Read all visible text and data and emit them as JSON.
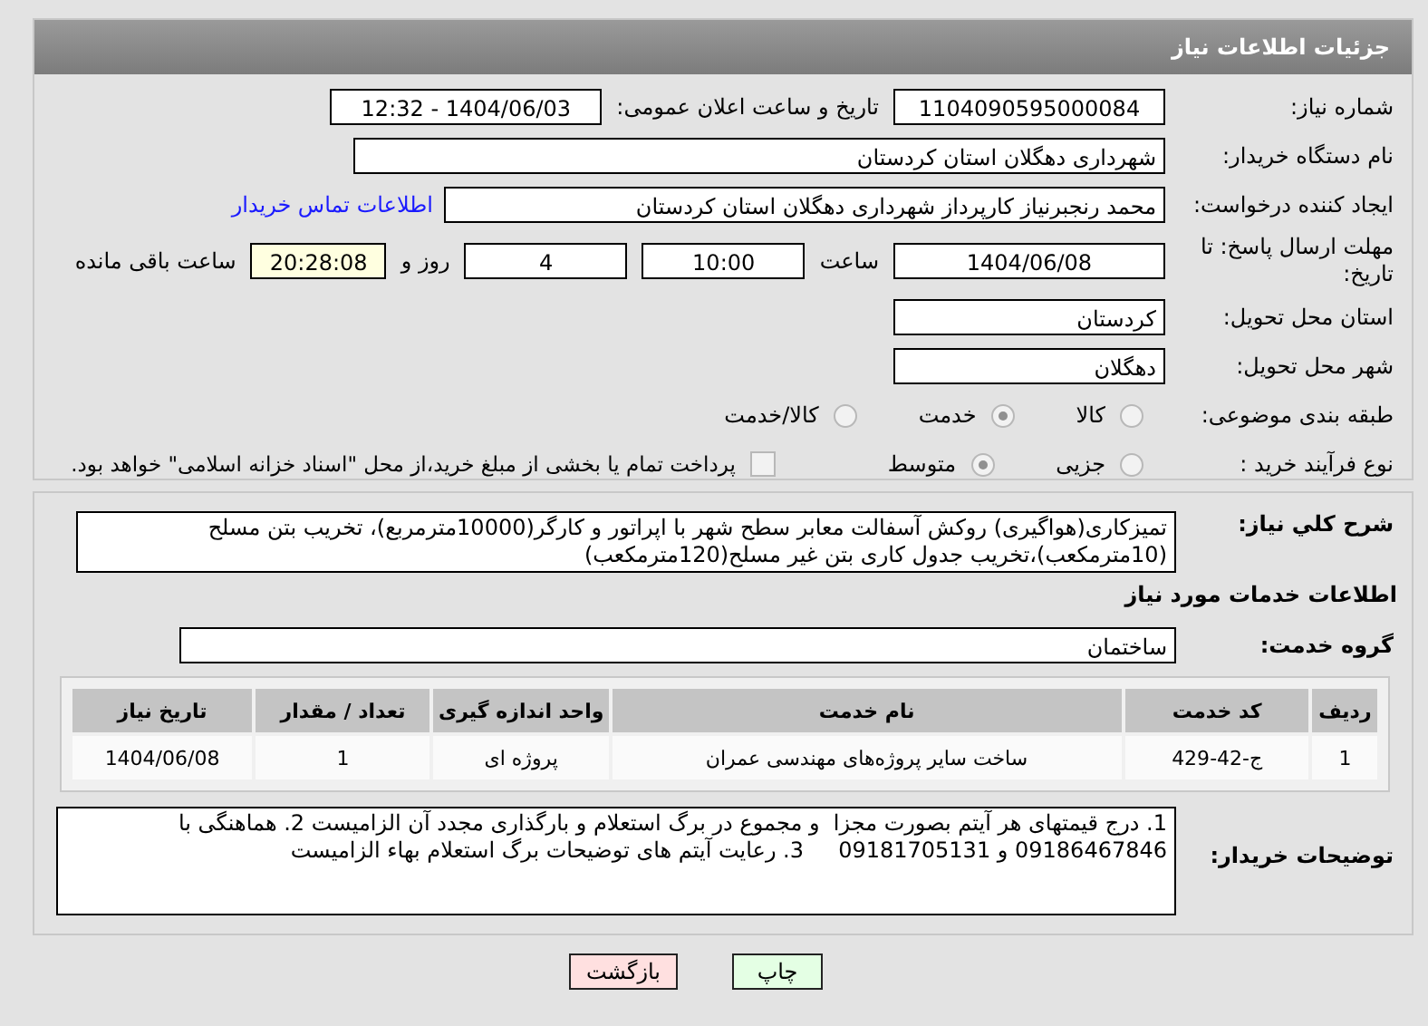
{
  "page_title": "جزئیات اطلاعات نیاز",
  "need_number": {
    "label": "شماره نیاز:",
    "value": "1104090595000084"
  },
  "announce": {
    "label": "تاریخ و ساعت اعلان عمومی:",
    "value": "1404/06/03 - 12:32"
  },
  "buyer": {
    "label": "نام دستگاه خریدار:",
    "value": "شهرداری دهگلان استان کردستان"
  },
  "requester": {
    "label": "ایجاد کننده درخواست:",
    "value": "محمد رنجبرنیاز کارپرداز شهرداری دهگلان استان کردستان",
    "link": "اطلاعات تماس خریدار"
  },
  "deadline": {
    "label": "مهلت ارسال پاسخ: تا تاریخ:",
    "date": "1404/06/08",
    "time_label": "ساعت",
    "time": "10:00",
    "days": "4",
    "days_label": "روز و",
    "remaining": "20:28:08",
    "remaining_label": "ساعت باقی مانده"
  },
  "province": {
    "label": "استان محل تحویل:",
    "value": "کردستان"
  },
  "city": {
    "label": "شهر محل تحویل:",
    "value": "دهگلان"
  },
  "category": {
    "label": "طبقه بندی موضوعی:",
    "options": [
      {
        "label": "کالا",
        "selected": false
      },
      {
        "label": "خدمت",
        "selected": true
      },
      {
        "label": "کالا/خدمت",
        "selected": false
      }
    ]
  },
  "process": {
    "label": "نوع فرآیند خرید :",
    "options": [
      {
        "label": "جزیی",
        "selected": false
      },
      {
        "label": "متوسط",
        "selected": true
      }
    ],
    "payment": {
      "checked": false,
      "text": "پرداخت تمام یا بخشی از مبلغ خرید،از محل \"اسناد خزانه اسلامی\" خواهد بود."
    }
  },
  "description": {
    "label": "شرح کلي نياز:",
    "text": "تمیزکاری(هواگیری) روکش آسفالت معابر سطح شهر با اپراتور و کارگر(10000مترمربع)، تخریب بتن مسلح (10مترمکعب)،تخریب جدول کاری بتن غیر مسلح(120مترمکعب)"
  },
  "services_heading": "اطلاعات خدمات مورد نیاز",
  "service_group": {
    "label": "گروه خدمت:",
    "value": "ساختمان"
  },
  "table": {
    "columns": [
      "ردیف",
      "کد خدمت",
      "نام خدمت",
      "واحد اندازه گیری",
      "تعداد / مقدار",
      "تاریخ نیاز"
    ],
    "rows": [
      [
        "1",
        "ج-42-429",
        "ساخت سایر پروژه‌های مهندسی عمران",
        "پروژه ای",
        "1",
        "1404/06/08"
      ]
    ]
  },
  "buyer_notes": {
    "label": "توضیحات خریدار:",
    "text": "1. درج قیمتهای هر آیتم بصورت مجزا  و مجموع در برگ استعلام و بارگذاری مجدد آن الزامیست 2. هماهنگی با 09186467846 و 09181705131     3. رعایت آیتم های توضیحات برگ استعلام بهاء الزامیست"
  },
  "buttons": [
    {
      "label": "چاپ",
      "kind": "print"
    },
    {
      "label": "بازگشت",
      "kind": "back"
    }
  ]
}
